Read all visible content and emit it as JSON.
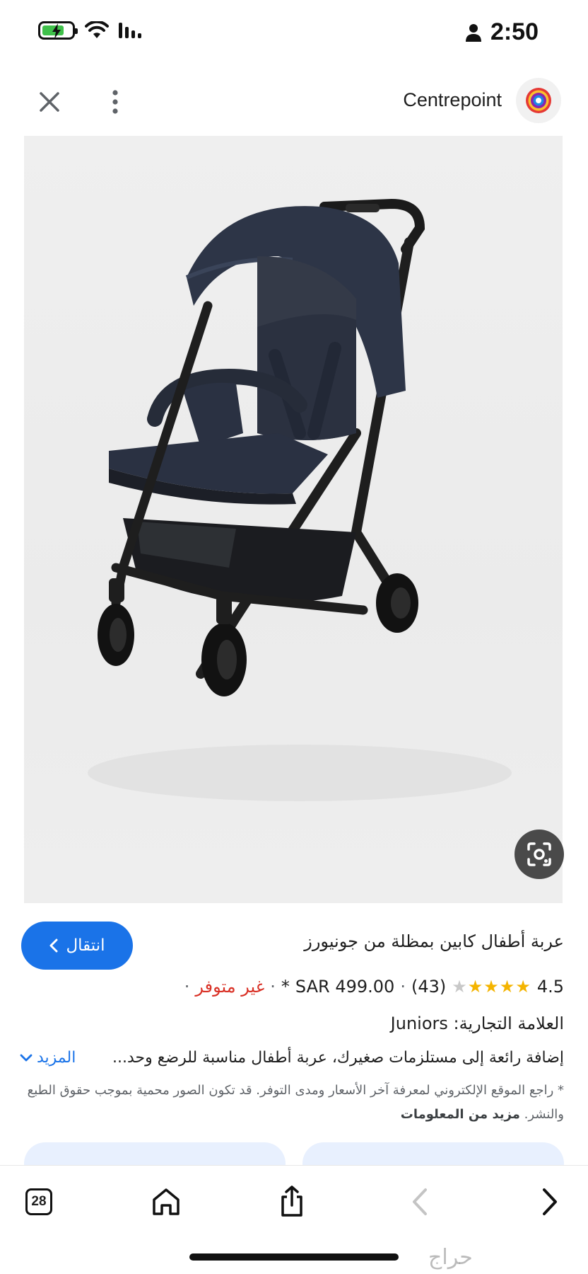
{
  "status_bar": {
    "time": "2:50",
    "icons": [
      "battery-charging-icon",
      "wifi-icon",
      "cellular-signal-icon",
      "person-icon"
    ]
  },
  "header": {
    "site_name": "Centrepoint",
    "icons": [
      "close-icon",
      "more-vert-icon",
      "site-logo-icon"
    ]
  },
  "image": {
    "lens_icon": "google-lens-icon"
  },
  "product": {
    "go_button_label": "انتقال",
    "title": "عربة أطفال كابين بمظلة من جونيورز",
    "rating": "4.5",
    "rating_value": 4.5,
    "reviews": "(43)",
    "price": "SAR 499.00",
    "price_marker": "*",
    "availability": "غير متوفر",
    "brand": "العلامة التجارية: Juniors",
    "description": "إضافة رائعة إلى مستلزمات صغيرك، عربة أطفال مناسبة للرضع وحد...",
    "more_label": "المزيد",
    "note": "* راجع الموقع الإلكتروني لمعرفة آخر الأسعار ومدى التوفر. قد تكون الصور محمية بموجب حقوق الطبع والنشر.",
    "note_link": "مزيد من المعلومات"
  },
  "toolbar": {
    "tabs_count": "28",
    "icons": [
      "tabs-icon",
      "home-icon",
      "share-icon",
      "back-icon",
      "forward-icon"
    ]
  },
  "watermark": "حراج",
  "colors": {
    "accent": "#1a73e8",
    "unavailable": "#d93025",
    "star": "#f4b400"
  }
}
